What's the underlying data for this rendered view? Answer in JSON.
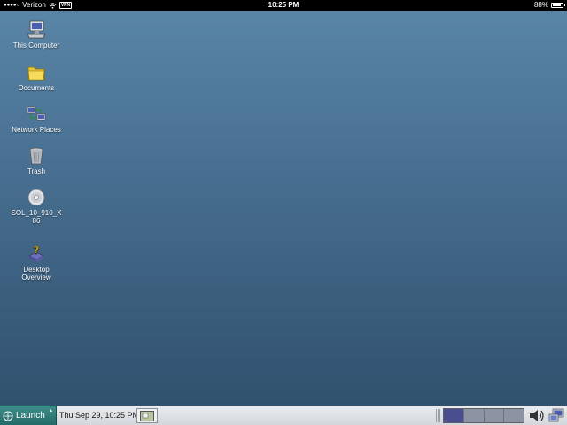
{
  "status_bar": {
    "carrier": "Verizon",
    "vpn": "VPN",
    "time": "10:25 PM",
    "battery": "88%",
    "battery_level": 0.88,
    "signal_icon": "signal-dots-icon",
    "wifi_icon": "wifi-icon"
  },
  "desktop": {
    "icons": [
      {
        "label": "This Computer",
        "icon": "computer-icon"
      },
      {
        "label": "Documents",
        "icon": "folder-icon"
      },
      {
        "label": "Network Places",
        "icon": "network-icon"
      },
      {
        "label": "Trash",
        "icon": "trash-icon"
      },
      {
        "label": "SOL_10_910_X86",
        "icon": "cd-icon"
      },
      {
        "label": "Desktop Overview",
        "icon": "help-icon"
      }
    ]
  },
  "panel": {
    "launch_label": "Launch",
    "clock": "Thu Sep 29, 10:25 PM",
    "workspaces": 4,
    "active_workspace": 1
  },
  "colors": {
    "desktop_top": "#5a86a8",
    "desktop_bottom": "#2f4f6c",
    "launch_bg": "#2e7b78",
    "workspace_active": "#4a4d8e"
  }
}
